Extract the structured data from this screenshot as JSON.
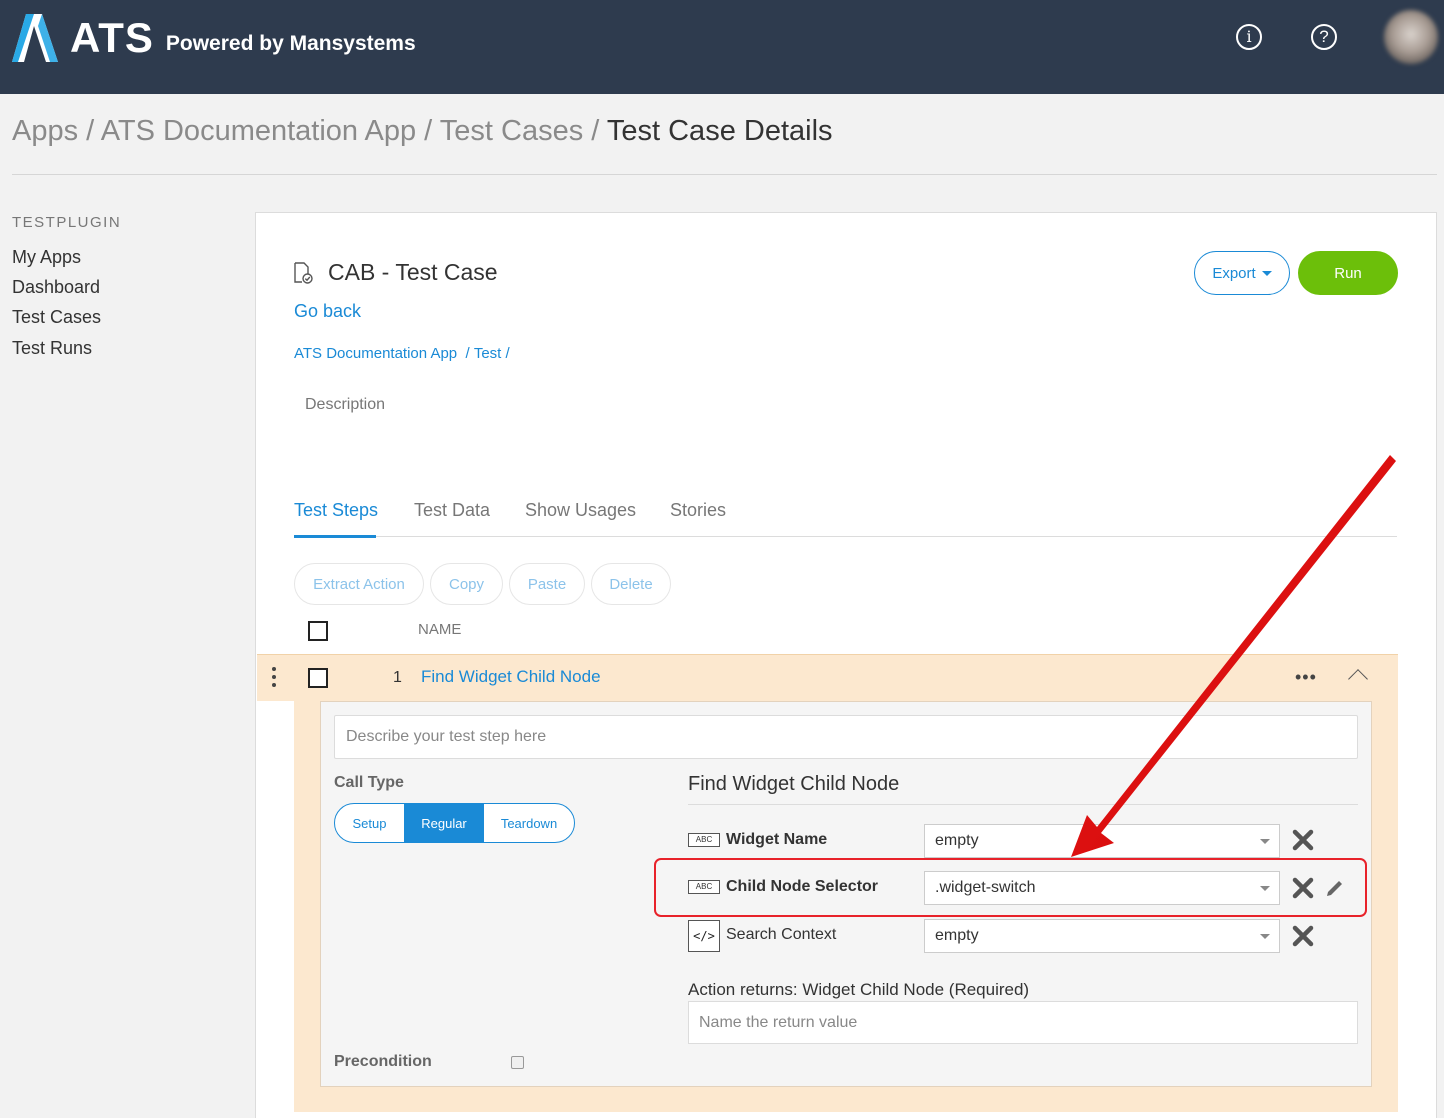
{
  "header": {
    "logo_text": "ATS",
    "powered_by": "Powered by Mansystems",
    "info_icon": "info-icon",
    "help_icon": "help-icon",
    "info_glyph": "i",
    "help_glyph": "?"
  },
  "breadcrumb": {
    "apps": "Apps",
    "sep": " / ",
    "app": "ATS Documentation App",
    "test_cases": "Test Cases",
    "current": "Test Case Details"
  },
  "sidebar": {
    "heading": "TESTPLUGIN",
    "items": [
      {
        "label": "My Apps"
      },
      {
        "label": "Dashboard"
      },
      {
        "label": "Test Cases"
      },
      {
        "label": "Test Runs"
      }
    ]
  },
  "test_case": {
    "title": "CAB - Test Case",
    "go_back": "Go back",
    "path_app": "ATS Documentation App",
    "path_folder": "Test",
    "description_label": "Description",
    "export_label": "Export",
    "run_label": "Run"
  },
  "tabs": [
    {
      "label": "Test Steps",
      "active": true
    },
    {
      "label": "Test Data"
    },
    {
      "label": "Show Usages"
    },
    {
      "label": "Stories"
    }
  ],
  "toolbar": {
    "extract": "Extract Action",
    "copy": "Copy",
    "paste": "Paste",
    "delete": "Delete"
  },
  "steps_table": {
    "name_header": "NAME",
    "row": {
      "number": "1",
      "name": "Find Widget Child Node",
      "more": "•••"
    }
  },
  "step_detail": {
    "description_placeholder": "Describe your test step here",
    "call_type_label": "Call Type",
    "call_types": [
      "Setup",
      "Regular",
      "Teardown"
    ],
    "call_type_selected": "Regular",
    "action_title": "Find Widget Child Node",
    "params": [
      {
        "type_badge": "ABC",
        "name": "Widget Name",
        "value": "empty"
      },
      {
        "type_badge": "ABC",
        "name": "Child Node Selector",
        "value": ".widget-switch"
      },
      {
        "type_badge": "</>",
        "name": "Search Context",
        "value": "empty"
      }
    ],
    "returns_label": "Action returns: Widget Child Node (Required)",
    "return_placeholder": "Name the return value",
    "precondition_label": "Precondition"
  },
  "colors": {
    "header_bg": "#2e3b4e",
    "accent": "#1a8ad6",
    "run_green": "#6cbf0a",
    "row_highlight": "#fce8cf",
    "annotation_red": "#e8222a"
  }
}
